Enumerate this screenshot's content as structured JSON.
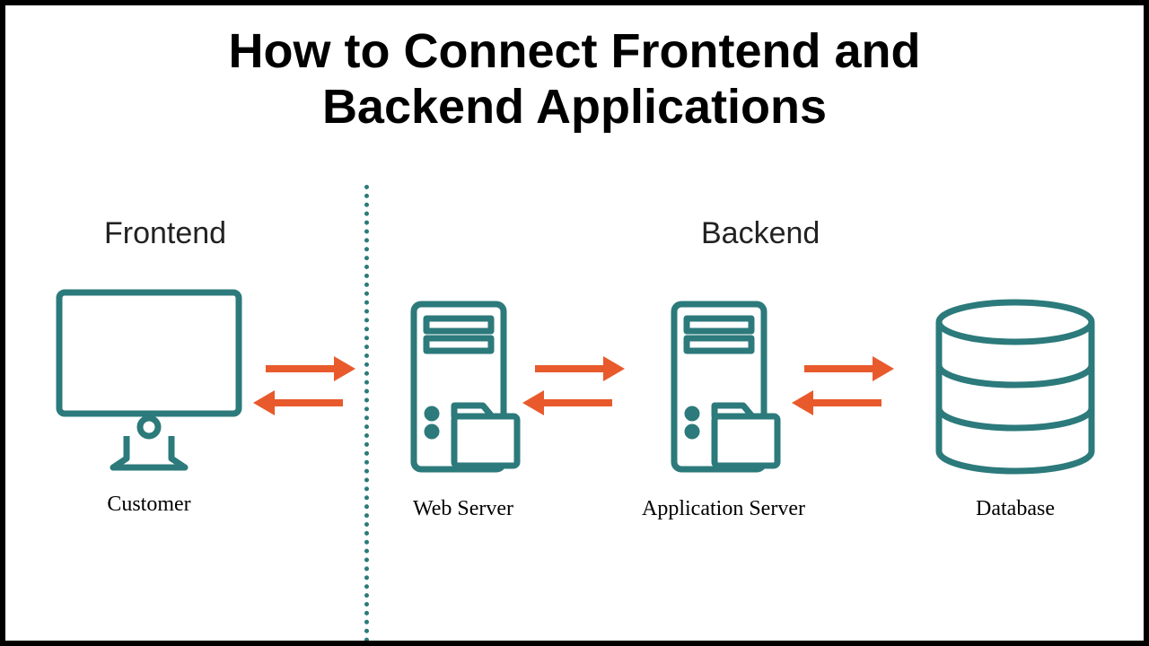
{
  "title_line1": "How to Connect Frontend and",
  "title_line2": "Backend Applications",
  "sections": {
    "frontend": "Frontend",
    "backend": "Backend"
  },
  "nodes": {
    "customer": "Customer",
    "webserver": "Web Server",
    "appserver": "Application Server",
    "database": "Database"
  },
  "colors": {
    "teal": "#2c7a7b",
    "arrow": "#e85a2c"
  }
}
